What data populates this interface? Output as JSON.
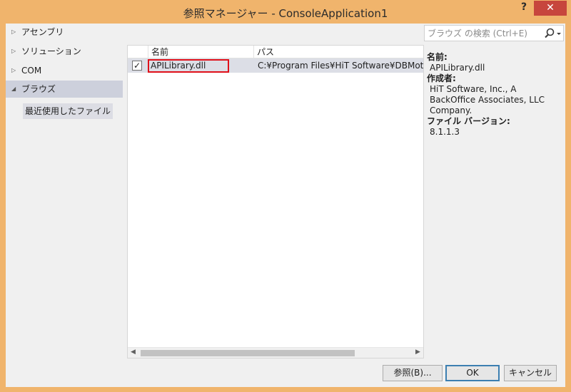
{
  "window": {
    "title": "参照マネージャー - ConsoleApplication1",
    "help_label": "?",
    "close_label": "✕"
  },
  "nav": {
    "items": [
      {
        "label": "アセンブリ",
        "arrow": "▷",
        "selected": false
      },
      {
        "label": "ソリューション",
        "arrow": "▷",
        "selected": false
      },
      {
        "label": "COM",
        "arrow": "▷",
        "selected": false
      },
      {
        "label": "ブラウズ",
        "arrow": "◢",
        "selected": true
      }
    ],
    "sub_item": "最近使用したファイル"
  },
  "list": {
    "columns": [
      "名前",
      "パス"
    ],
    "rows": [
      {
        "checked": true,
        "check_glyph": "✓",
        "name": "APILibrary.dll",
        "path": "C:¥Program Files¥HiT Software¥DBMoto"
      }
    ]
  },
  "search": {
    "placeholder": "ブラウズ の検索 (Ctrl+E)"
  },
  "details": {
    "name_label": "名前:",
    "name_value": "APILibrary.dll",
    "author_label": "作成者:",
    "author_value": "HiT Software, Inc., A BackOffice Associates, LLC Company.",
    "version_label": "ファイル バージョン:",
    "version_value": "8.1.1.3"
  },
  "buttons": {
    "browse": "参照(B)...",
    "ok": "OK",
    "cancel": "キャンセル"
  },
  "colors": {
    "title_bar": "#f0b46c",
    "close_button": "#c7463d",
    "selection": "#cdd0dc",
    "highlight_box": "#e0101a"
  }
}
